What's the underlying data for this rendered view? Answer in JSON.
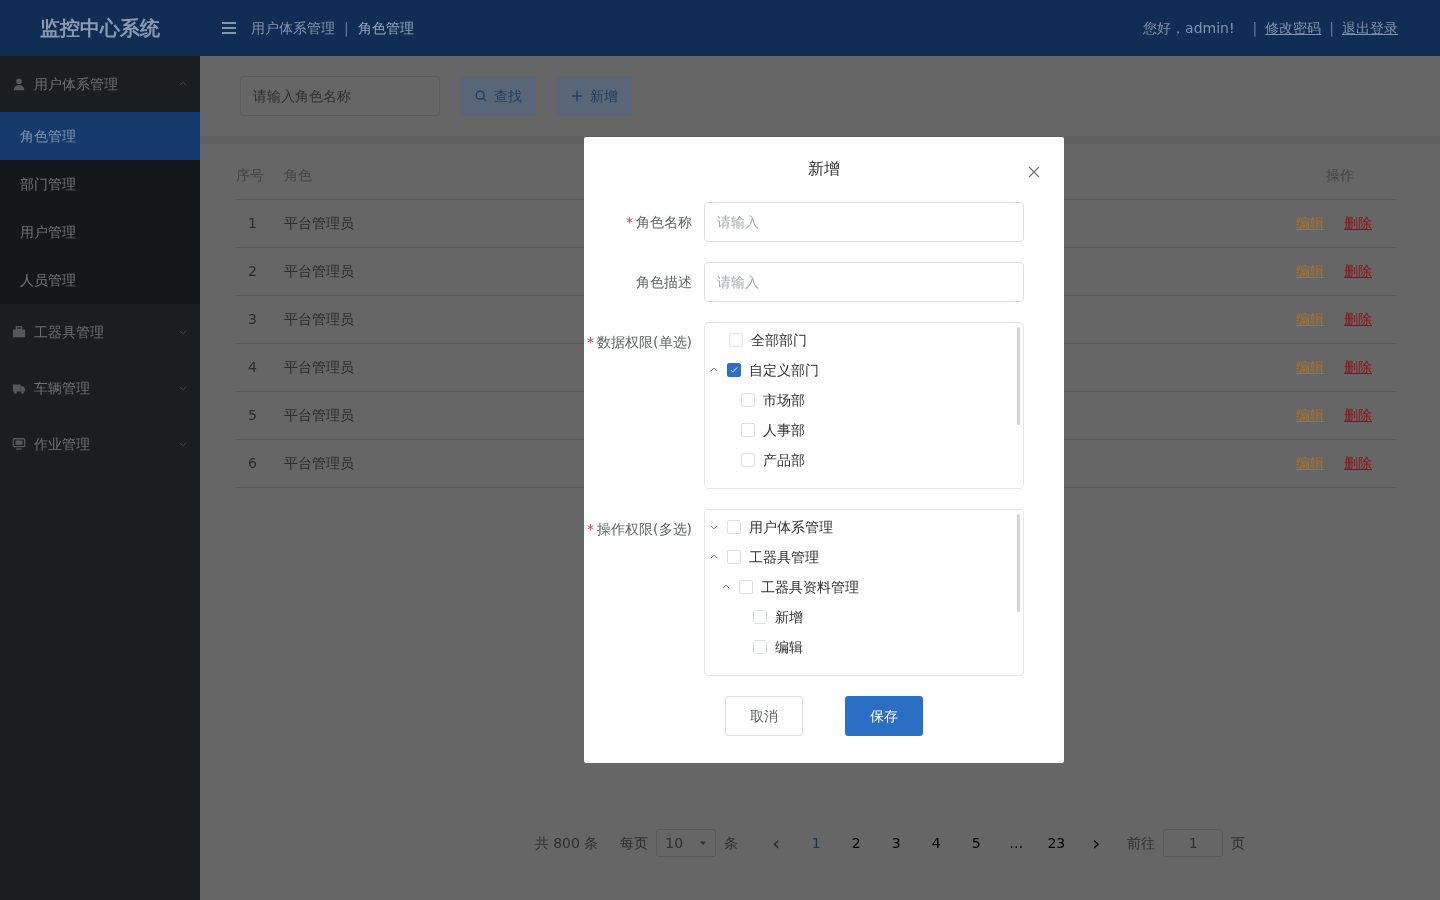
{
  "header": {
    "title": "监控中心系统",
    "breadcrumb": [
      "用户体系管理",
      "角色管理"
    ],
    "breadcrumb_separator": "|",
    "greeting": "您好，admin!",
    "link_separator": "|",
    "links": [
      "修改密码",
      "退出登录"
    ]
  },
  "sidebar": [
    {
      "label": "用户体系管理",
      "expanded": true,
      "children": [
        {
          "label": "角色管理",
          "selected": true
        },
        {
          "label": "部门管理",
          "selected": false
        },
        {
          "label": "用户管理",
          "selected": false
        },
        {
          "label": "人员管理",
          "selected": false
        }
      ]
    },
    {
      "label": "工器具管理",
      "expanded": false
    },
    {
      "label": "车辆管理",
      "expanded": false
    },
    {
      "label": "作业管理",
      "expanded": false
    }
  ],
  "toolbar": {
    "search": {
      "placeholder": "请输入角色名称"
    },
    "buttons": [
      {
        "label": "查找"
      },
      {
        "label": "新增"
      }
    ]
  },
  "table": {
    "columns": [
      "序号",
      "角色",
      "操作"
    ],
    "rows": [
      {
        "index": "1",
        "role": "平台管理员",
        "actions": [
          "编辑",
          "删除"
        ]
      },
      {
        "index": "2",
        "role": "平台管理员",
        "actions": [
          "编辑",
          "删除"
        ]
      },
      {
        "index": "3",
        "role": "平台管理员",
        "actions": [
          "编辑",
          "删除"
        ]
      },
      {
        "index": "4",
        "role": "平台管理员",
        "actions": [
          "编辑",
          "删除"
        ]
      },
      {
        "index": "5",
        "role": "平台管理员",
        "actions": [
          "编辑",
          "删除"
        ]
      },
      {
        "index": "6",
        "role": "平台管理员",
        "actions": [
          "编辑",
          "删除"
        ]
      }
    ]
  },
  "pagination": {
    "total": "共 800 条",
    "per_page_label": "每页",
    "per_page": "10",
    "per_page_unit": "条",
    "prev": "‹",
    "pages": [
      {
        "label": "1",
        "selected": true
      },
      {
        "label": "2",
        "selected": false
      },
      {
        "label": "3",
        "selected": false
      },
      {
        "label": "4",
        "selected": false
      },
      {
        "label": "5",
        "selected": false
      },
      {
        "label": "…",
        "selected": false
      },
      {
        "label": "23",
        "selected": false
      }
    ],
    "next": "›",
    "goto_label": "前往",
    "goto_value": "1",
    "goto_unit": "页"
  },
  "dialog": {
    "title": "新增",
    "fields": [
      {
        "kind": "input",
        "required_mark": "*",
        "label": "角色名称",
        "placeholder": "请输入"
      },
      {
        "kind": "input",
        "label": "角色描述",
        "placeholder": "请输入"
      },
      {
        "kind": "tree",
        "required_mark": "*",
        "label": "数据权限(单选)",
        "nodes": [
          {
            "label": "全部部门",
            "checked": false
          },
          {
            "label": "自定义部门",
            "checked": true,
            "expanded": true,
            "children": [
              {
                "label": "市场部",
                "checked": false
              },
              {
                "label": "人事部",
                "checked": false
              },
              {
                "label": "产品部",
                "checked": false
              }
            ]
          }
        ]
      },
      {
        "kind": "tree",
        "required_mark": "*",
        "label": "操作权限(多选)",
        "nodes": [
          {
            "label": "用户体系管理",
            "checked": false,
            "expanded": false
          },
          {
            "label": "工器具管理",
            "checked": false,
            "expanded": true,
            "children": [
              {
                "label": "工器具资料管理",
                "checked": false,
                "expanded": true,
                "children": [
                  {
                    "label": "新增",
                    "checked": false
                  },
                  {
                    "label": "编辑",
                    "checked": false
                  }
                ]
              }
            ]
          }
        ]
      }
    ],
    "buttons": [
      {
        "label": "取消",
        "kind": "secondary"
      },
      {
        "label": "保存",
        "kind": "primary"
      }
    ]
  }
}
